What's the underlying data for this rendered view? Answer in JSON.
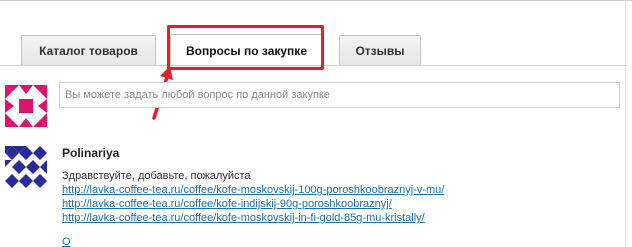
{
  "tabs": [
    {
      "label": "Каталог товаров",
      "active": false
    },
    {
      "label": "Вопросы по закупке",
      "active": true
    },
    {
      "label": "Отзывы",
      "active": false
    }
  ],
  "question_form": {
    "placeholder": "Вы можете задать любой вопрос по данной закупке"
  },
  "comment": {
    "author": "Polinariya",
    "text": "Здравствуйте, добавьте, пожалуйста",
    "links": [
      "http://lavka-coffee-tea.ru/coffee/kofe-moskovskij-100g-poroshkoobraznyj-v-mu/",
      "http://lavka-coffee-tea.ru/coffee/kofe-indijskij-90g-poroshkoobraznyj/",
      "http://lavka-coffee-tea.ru/coffee/kofe-moskovskij-in-fi-gold-85g-mu-kristally/"
    ],
    "reply_label": "О"
  },
  "colors": {
    "annotation": "#e0202a",
    "link": "#1a6fb0",
    "avatar_me": "#d6156b",
    "avatar_user": "#2a2a9a"
  },
  "icons": {
    "annotation_arrow": "arrow-icon",
    "avatar_me": "avatar-pattern-icon",
    "avatar_user": "avatar-pattern-icon"
  }
}
